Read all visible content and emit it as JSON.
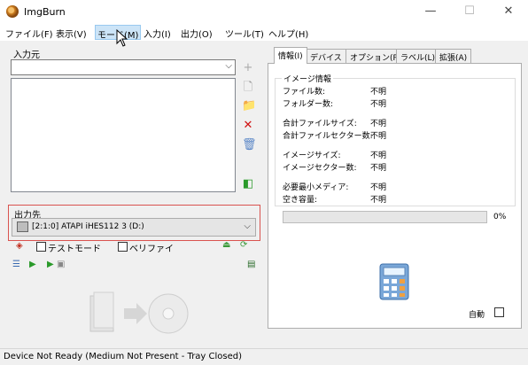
{
  "window": {
    "title": "ImgBurn",
    "minimize": "—",
    "maximize": "☐",
    "close": "✕"
  },
  "menu": [
    {
      "label": "ファイル(F)"
    },
    {
      "label": "表示(V)"
    },
    {
      "label": "モード(M)"
    },
    {
      "label": "入力(I)"
    },
    {
      "label": "出力(O)"
    },
    {
      "label": "ツール(T)"
    },
    {
      "label": "ヘルプ(H)"
    }
  ],
  "source": {
    "label": "入力元",
    "selected": ""
  },
  "destination": {
    "label": "出力先",
    "device": "[2:1:0] ATAPI iHES112   3 (D:)"
  },
  "options": {
    "test_mode": "テストモード",
    "test_mode_checked": false,
    "verify": "ベリファイ",
    "verify_checked": false
  },
  "tabs": [
    {
      "label": "情報(I)",
      "active": true
    },
    {
      "label": "デバイス"
    },
    {
      "label": "オプション(P)"
    },
    {
      "label": "ラベル(L)"
    },
    {
      "label": "拡張(A)"
    }
  ],
  "info": {
    "legend": "イメージ情報",
    "rows": [
      {
        "key": "ファイル数:",
        "value": "不明"
      },
      {
        "key": "フォルダー数:",
        "value": "不明"
      },
      {
        "key": "合計ファイルサイズ:",
        "value": "不明"
      },
      {
        "key": "合計ファイルセクター数:",
        "value": "不明"
      },
      {
        "key": "イメージサイズ:",
        "value": "不明"
      },
      {
        "key": "イメージセクター数:",
        "value": "不明"
      },
      {
        "key": "必要最小メディア:",
        "value": "不明"
      },
      {
        "key": "空き容量:",
        "value": "不明"
      }
    ]
  },
  "progress": {
    "percent": 0,
    "label": "0%"
  },
  "auto": {
    "label": "自動",
    "checked": false
  },
  "status": {
    "text": "Device Not Ready (Medium Not Present - Tray Closed)"
  },
  "colors": {
    "accent": "#0078d7",
    "dest_border": "#d9534f",
    "progress_fill": "#06b025"
  }
}
